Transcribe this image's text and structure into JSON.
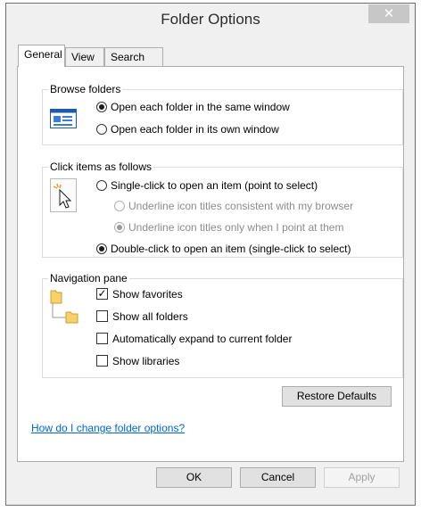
{
  "window": {
    "title": "Folder Options",
    "close_glyph": "✕"
  },
  "tabs": [
    {
      "label": "General",
      "active": true
    },
    {
      "label": "View",
      "active": false
    },
    {
      "label": "Search",
      "active": false
    }
  ],
  "browse_folders": {
    "label": "Browse folders",
    "icon": "same-window-icon",
    "options": [
      {
        "label": "Open each folder in the same window",
        "checked": true
      },
      {
        "label": "Open each folder in its own window",
        "checked": false
      }
    ]
  },
  "click_items": {
    "label": "Click items as follows",
    "icon": "pointer-click-icon",
    "options": [
      {
        "label": "Single-click to open an item (point to select)",
        "checked": false,
        "enabled": true
      },
      {
        "label": "Underline icon titles consistent with my browser",
        "checked": false,
        "enabled": false
      },
      {
        "label": "Underline icon titles only when I point at them",
        "checked": true,
        "enabled": false
      },
      {
        "label": "Double-click to open an item (single-click to select)",
        "checked": true,
        "enabled": true
      }
    ]
  },
  "navigation_pane": {
    "label": "Navigation pane",
    "icon": "folder-tree-icon",
    "options": [
      {
        "label": "Show favorites",
        "checked": true
      },
      {
        "label": "Show all folders",
        "checked": false
      },
      {
        "label": "Automatically expand to current folder",
        "checked": false
      },
      {
        "label": "Show libraries",
        "checked": false
      }
    ]
  },
  "restore_defaults_label": "Restore Defaults",
  "help_link": "How do I change folder options?",
  "footer": {
    "ok": "OK",
    "cancel": "Cancel",
    "apply": "Apply"
  },
  "check_glyph": "✓",
  "colors": {
    "link": "#0066cc",
    "folder": "#f7d26a",
    "accent_blue": "#1e5aa8"
  }
}
